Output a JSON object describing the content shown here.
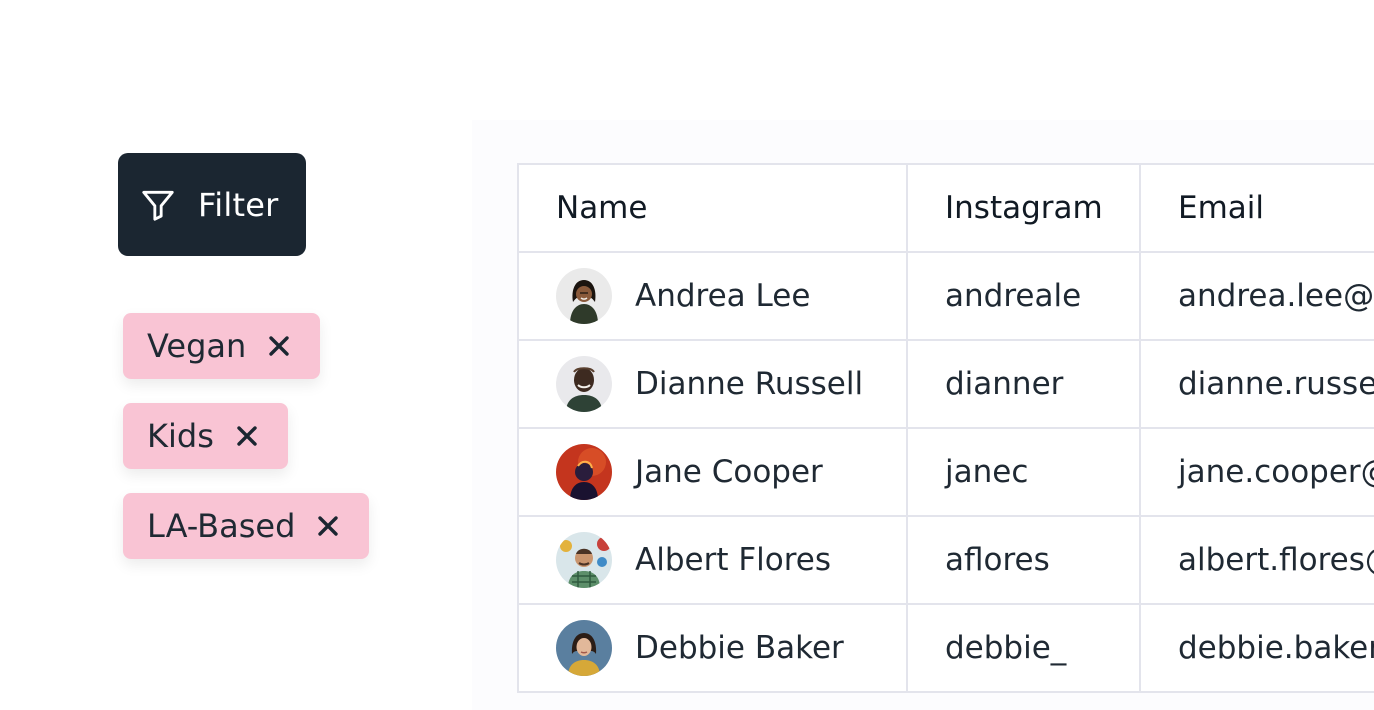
{
  "filter": {
    "label": "Filter",
    "icon": "filter-funnel-icon"
  },
  "tags": [
    {
      "label": "Vegan",
      "icon": "close-icon"
    },
    {
      "label": "Kids",
      "icon": "close-icon"
    },
    {
      "label": "LA-Based",
      "icon": "close-icon"
    }
  ],
  "table": {
    "headers": [
      "Name",
      "Instagram",
      "Email"
    ],
    "rows": [
      {
        "name": "Andrea Lee",
        "instagram": "andreale",
        "email": "andrea.lee@example.com",
        "avatar": "avatar-andrea-lee"
      },
      {
        "name": "Dianne Russell",
        "instagram": "dianner",
        "email": "dianne.russell@example.com",
        "avatar": "avatar-dianne-russell"
      },
      {
        "name": "Jane Cooper",
        "instagram": "janec",
        "email": "jane.cooper@example.com",
        "avatar": "avatar-jane-cooper"
      },
      {
        "name": "Albert Flores",
        "instagram": "aflores",
        "email": "albert.flores@example.com",
        "avatar": "avatar-albert-flores"
      },
      {
        "name": "Debbie Baker",
        "instagram": "debbie_",
        "email": "debbie.baker@example.com",
        "avatar": "avatar-debbie-baker"
      }
    ]
  },
  "colors": {
    "filter_button_bg": "#1b2631",
    "tag_bg": "#f9c4d4",
    "table_border": "#e3e4ec"
  }
}
